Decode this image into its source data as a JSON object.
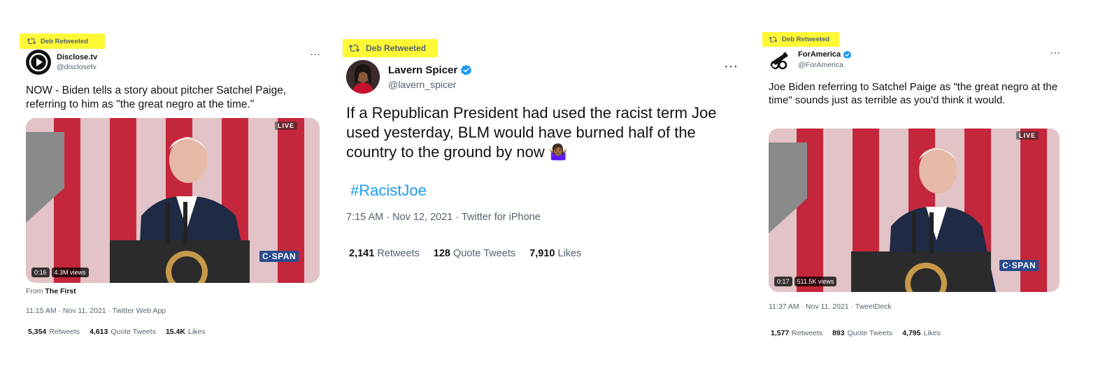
{
  "colors": {
    "retweet_highlight": "#fff836",
    "link_blue": "#1d9bf0",
    "verified_blue": "#1d9bf0",
    "secondary_text": "#536471",
    "flag_red": "#c4263b",
    "flag_pink": "#e2c3c7",
    "suit_navy": "#1f2a44"
  },
  "tweets": [
    {
      "retweeted_by": "Deb Retweeted",
      "author_name": "Disclose.tv",
      "author_handle": "@disclosetv",
      "more_label": "···",
      "text": "NOW - Biden tells a story about pitcher Satchel Paige, referring to him as \"the great negro at the time.\"",
      "video": {
        "live_label": "LIVE",
        "duration": "0:16",
        "views": "4.3M views",
        "network_label": "C·SPAN"
      },
      "source_prefix": "From",
      "source_name": "The First",
      "timestamp": "11:15 AM · Nov 11, 2021 · Twitter Web App",
      "stats": [
        {
          "value": "5,354",
          "label": "Retweets"
        },
        {
          "value": "4,613",
          "label": "Quote Tweets"
        },
        {
          "value": "15.4K",
          "label": "Likes"
        }
      ]
    },
    {
      "retweeted_by": "Deb Retweeted",
      "author_name": "Lavern Spicer",
      "author_handle": "@lavern_spicer",
      "verified": true,
      "more_label": "···",
      "text": "If a Republican President had used the racist term Joe used yesterday, BLM would have burned half of the country to the ground by now 🤷🏾‍♀️",
      "hashtag": "#RacistJoe",
      "timestamp": "7:15 AM · Nov 12, 2021 · Twitter for iPhone",
      "stats": [
        {
          "value": "2,141",
          "label": "Retweets"
        },
        {
          "value": "128",
          "label": "Quote Tweets"
        },
        {
          "value": "7,910",
          "label": "Likes"
        }
      ]
    },
    {
      "retweeted_by": "Deb Retweeted",
      "author_name": "ForAmerica",
      "author_handle": "@ForAmerica",
      "verified": true,
      "more_label": "···",
      "text": "Joe Biden referring to Satchel Paige as \"the great negro at the time\" sounds just as terrible as you'd think it would.",
      "video": {
        "live_label": "LIVE",
        "duration": "0:17",
        "views": "511.5K views",
        "network_label": "C·SPAN"
      },
      "timestamp": "11:37 AM · Nov 11, 2021 · TweetDeck",
      "stats": [
        {
          "value": "1,577",
          "label": "Retweets"
        },
        {
          "value": "893",
          "label": "Quote Tweets"
        },
        {
          "value": "4,795",
          "label": "Likes"
        }
      ]
    }
  ]
}
